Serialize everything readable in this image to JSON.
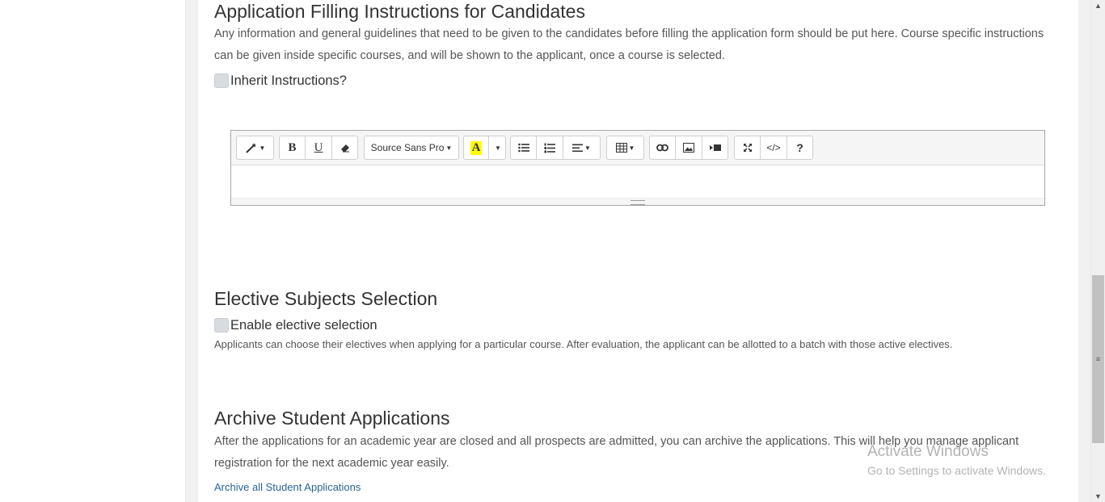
{
  "app_instructions": {
    "title": "Application Filling Instructions for Candidates",
    "description": "Any information and general guidelines that need to be given to the candidates before filling the application form should be put here. Course specific instructions can be given inside specific courses, and will be shown to the applicant, once a course is selected.",
    "inherit_label": "Inherit Instructions?",
    "inherit_checked": false
  },
  "editor": {
    "font_name": "Source Sans Pro",
    "buttons": {
      "bold": "B",
      "underline": "U",
      "color": "A",
      "code": "</>",
      "help": "?"
    },
    "content": ""
  },
  "electives": {
    "title": "Elective Subjects Selection",
    "checkbox_label": "Enable elective selection",
    "checked": false,
    "description": "Applicants can choose their electives when applying for a particular course. After evaluation, the applicant can be allotted to a batch with those active electives."
  },
  "archive": {
    "title": "Archive Student Applications",
    "description": "After the applications for an academic year are closed and all prospects are admitted, you can archive the applications. This will help you manage applicant registration for the next academic year easily.",
    "link_text": "Archive all Student Applications"
  },
  "watermark": {
    "title": "Activate Windows",
    "subtitle": "Go to Settings to activate Windows."
  },
  "colors": {
    "link": "#2a6496",
    "highlight": "#ffff00"
  }
}
